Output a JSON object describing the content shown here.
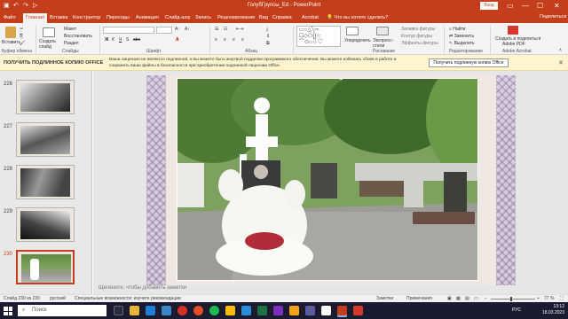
{
  "titlebar": {
    "title": "ГолубГрупсы_Ed - PowerPoint",
    "signin": "Вход",
    "win_controls": [
      "▭",
      "—",
      "☐",
      "✕"
    ]
  },
  "tabs": {
    "items": [
      "Файл",
      "Главная",
      "Вставка",
      "Конструктор",
      "Переходы",
      "Анимация",
      "Слайд-шоу",
      "Запись",
      "Рецензирование",
      "Вид",
      "Справка",
      "Acrobat"
    ],
    "active_index": 1,
    "tellme": "Что вы хотите сделать?",
    "share": "Поделиться"
  },
  "ribbon": {
    "paste": "Вставить",
    "clipboard": "Буфер обмена",
    "new_slide": "Создать слайд",
    "layout": "Макет",
    "reset": "Восстановить",
    "section": "Раздел",
    "slides": "Слайды",
    "font": "Шрифт",
    "paragraph": "Абзац",
    "arrange": "Упорядочить",
    "quick_styles": "Экспресс-стили",
    "shape_fill": "Заливка фигуры",
    "shape_outline": "Контур фигуры",
    "shape_effects": "Эффекты фигуры",
    "drawing": "Рисование",
    "find": "Найти",
    "replace": "Заменить",
    "select": "Выделить",
    "editing": "Редактирование",
    "create_share_1": "Создать и поделиться",
    "create_share_2": "Adobe PDF",
    "adobe_acrobat": "Adobe Acrobat"
  },
  "message_bar": {
    "heading": "ПОЛУЧИТЬ ПОДЛИННОЕ КОПИЮ OFFICE",
    "text": "Ваша лицензия не является подлинной, и вы можете быть жертвой подделки программного обеспечения. Вы можете избежать сбоев в работе и сохранить ваши файлы в безопасности при приобретении подлинной лицензии Office.",
    "button": "Получить подлинную копию Office",
    "close": "✕"
  },
  "thumbnails": {
    "numbers": [
      "226",
      "227",
      "228",
      "229",
      "230"
    ],
    "selected_index": 4
  },
  "notes": {
    "placeholder": "Щелкните, чтобы добавить заметки"
  },
  "statusbar": {
    "slide_info": "Слайд 230 из 230",
    "language": "русский",
    "accessibility": "Специальные возможности: изучите рекомендации",
    "notes": "Заметки",
    "comments": "Примечания",
    "zoom": "77 %"
  },
  "taskbar": {
    "search": "Поиск",
    "lang": "РУС",
    "time": "13:12",
    "date": "18.03.2023"
  },
  "colors": {
    "accent": "#c43e1c",
    "message_bar": "#fff4ce"
  }
}
